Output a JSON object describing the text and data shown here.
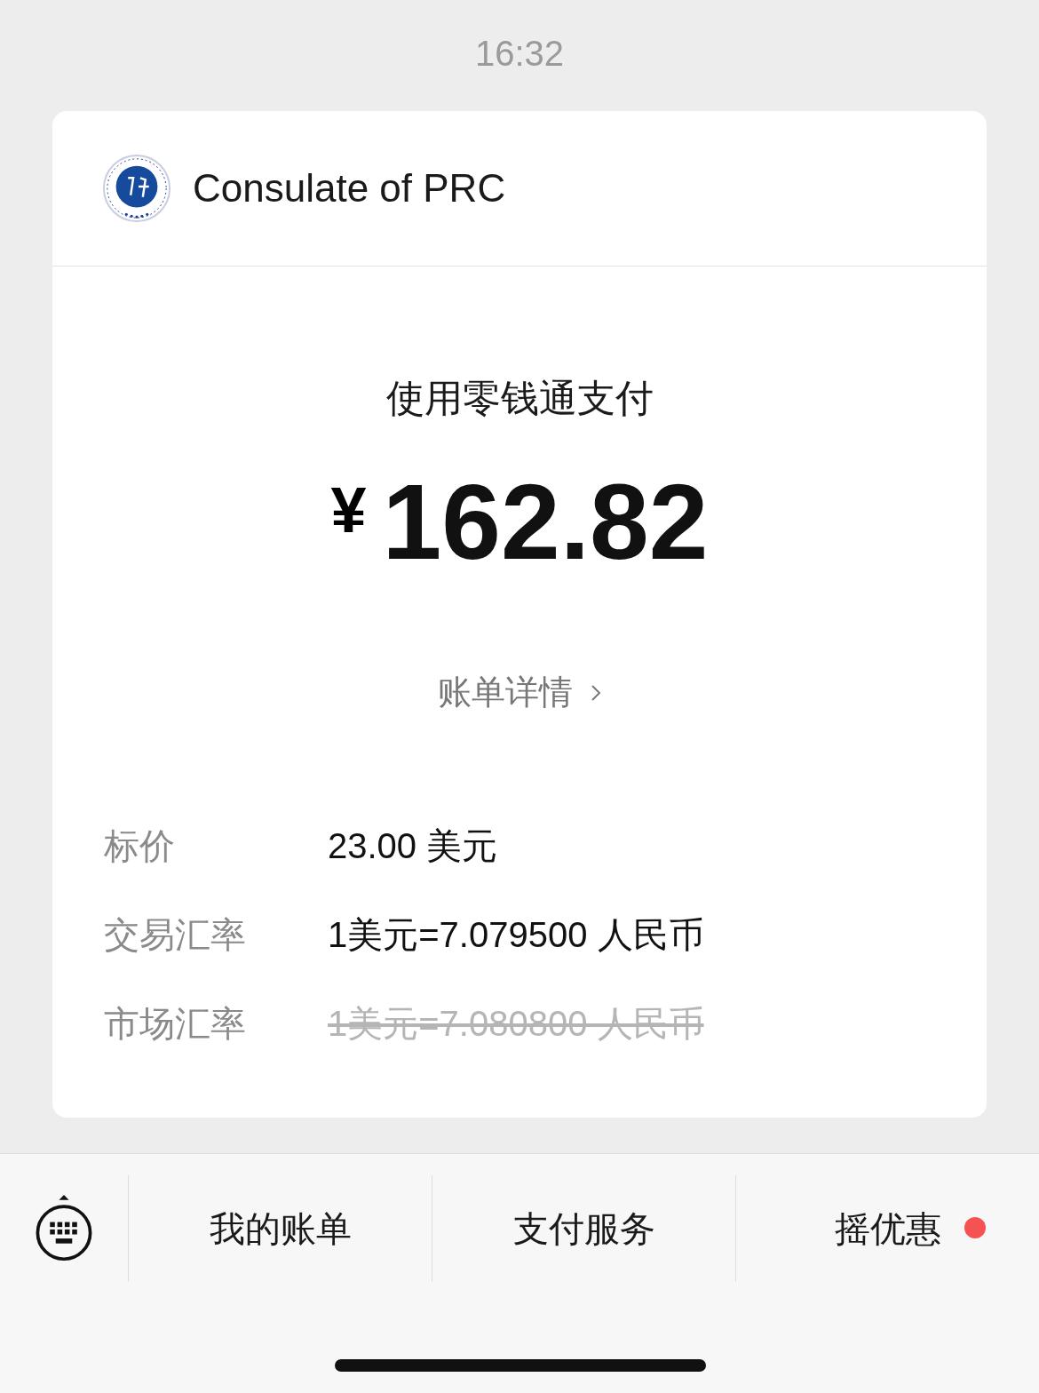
{
  "status_time": "16:32",
  "merchant": {
    "name": "Consulate of PRC"
  },
  "payment": {
    "method": "使用零钱通支付",
    "currency": "¥",
    "amount": "162.82",
    "details_link": "账单详情"
  },
  "rows": [
    {
      "label": "标价",
      "value": "23.00 美元",
      "struck": false
    },
    {
      "label": "交易汇率",
      "value": "1美元=7.079500 人民币",
      "struck": false
    },
    {
      "label": "市场汇率",
      "value": "1美元=7.080800 人民币",
      "struck": true
    }
  ],
  "menu": [
    {
      "label": "我的账单",
      "dot": false
    },
    {
      "label": "支付服务",
      "dot": false
    },
    {
      "label": "摇优惠",
      "dot": true
    }
  ]
}
